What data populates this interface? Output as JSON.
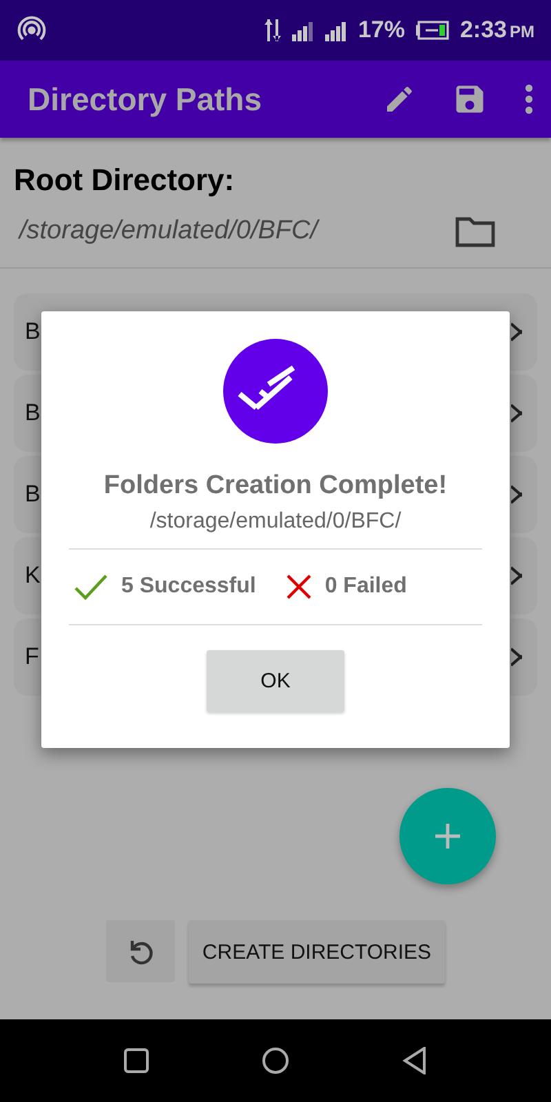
{
  "status_bar": {
    "battery": "17%",
    "time": "2:33",
    "time_suffix": "PM"
  },
  "app_bar": {
    "title": "Directory Paths"
  },
  "root": {
    "label": "Root Directory:",
    "path": "/storage/emulated/0/BFC/"
  },
  "paths": [
    {
      "label": "B"
    },
    {
      "label": "B"
    },
    {
      "label": "B"
    },
    {
      "label": "K"
    },
    {
      "label": "F"
    }
  ],
  "dialog": {
    "title": "Folders Creation Complete!",
    "path": "/storage/emulated/0/BFC/",
    "successful": "5 Successful",
    "failed": "0 Failed",
    "ok": "OK"
  },
  "create_button": "CREATE DIRECTORIES"
}
